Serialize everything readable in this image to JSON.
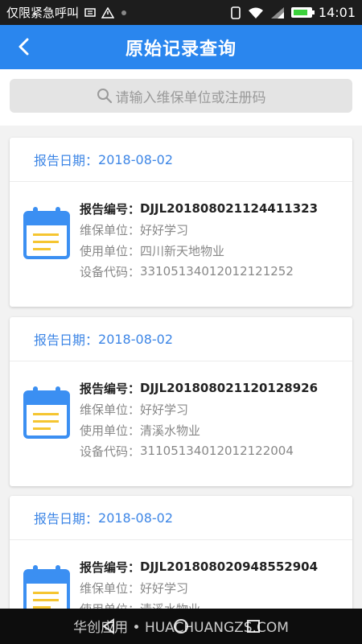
{
  "status_bar": {
    "carrier": "仅限紧急呼叫",
    "time": "14:01",
    "battery_level": 0.85
  },
  "header": {
    "title": "原始记录查询"
  },
  "search": {
    "placeholder": "请输入维保单位或注册码"
  },
  "labels": {
    "date": "报告日期：",
    "report_no": "报告编号：",
    "maintenance_unit": "维保单位：",
    "user_unit": "使用单位：",
    "device_code": "设备代码："
  },
  "records": [
    {
      "date": "2018-08-02",
      "report_no": "DJJL20180802112441132​3",
      "maintenance_unit": "好好学习",
      "user_unit": "四川新天地物业",
      "device_code": "33105134012012121252"
    },
    {
      "date": "2018-08-02",
      "report_no": "DJJL20180802112012892​6",
      "maintenance_unit": "好好学习",
      "user_unit": "清溪水物业",
      "device_code": "31105134012012122004"
    },
    {
      "date": "2018-08-02",
      "report_no": "DJJL20180802094855290​4",
      "maintenance_unit": "好好学习",
      "user_unit": "清溪水物业",
      "device_code": ""
    }
  ],
  "watermark": "华创应用 • HUACHUANGZS.COM",
  "colors": {
    "primary": "#2a86ee",
    "date_text": "#3d86e6",
    "calendar_icon": "#3b8ff2",
    "calendar_lines": "#f5c531"
  },
  "icons": {
    "back": "chevron-left-icon",
    "search": "search-icon",
    "record": "calendar-icon"
  }
}
